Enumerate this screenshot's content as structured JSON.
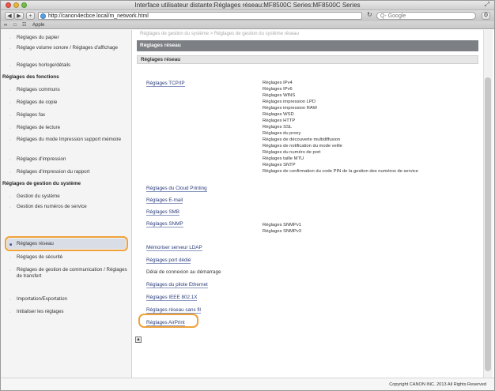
{
  "window": {
    "title": "Interface utilisateur distante:Réglages réseau:MF8500C Series:MF8500C Series"
  },
  "toolbar": {
    "url": "http://canon4ecbce.local/m_network.html",
    "search_placeholder": "Q- Google"
  },
  "bookmarks": [
    "Apple"
  ],
  "sidebar": {
    "items": [
      {
        "type": "item",
        "label": "Réglages du papier"
      },
      {
        "type": "item",
        "label": "Réglage volume sonore / Réglages d'affichage"
      },
      {
        "type": "item",
        "label": "Réglages horloge/détails"
      },
      {
        "type": "group",
        "label": "Réglages des fonctions"
      },
      {
        "type": "item",
        "label": "Réglages communs"
      },
      {
        "type": "item",
        "label": "Réglages de copie"
      },
      {
        "type": "item",
        "label": "Réglages fax"
      },
      {
        "type": "item",
        "label": "Réglages de lecture"
      },
      {
        "type": "item",
        "label": "Réglages du mode Impression support mémoire"
      },
      {
        "type": "item",
        "label": "Réglages d'impression"
      },
      {
        "type": "item",
        "label": "Réglages d'impression du rapport"
      },
      {
        "type": "group",
        "label": "Réglages de gestion du système"
      },
      {
        "type": "item",
        "label": "Gestion du système"
      },
      {
        "type": "item",
        "label": "Gestion des numéros de service"
      },
      {
        "type": "item",
        "label": "Réglages réseau",
        "active": true
      },
      {
        "type": "item",
        "label": "Réglages de sécurité"
      },
      {
        "type": "item",
        "label": "Réglages de gestion de communication / Réglages de transfert"
      },
      {
        "type": "item",
        "label": "Importation/Exportation"
      },
      {
        "type": "item",
        "label": "Initialiser les réglages"
      }
    ]
  },
  "main": {
    "prev_line": "Réglages de gestion du système > Réglages de gestion du système réseau",
    "section_title": "Réglages réseau",
    "subsection_title": "Réglages réseau",
    "tcpip": {
      "label": "Réglages TCP/IP",
      "sub_items": [
        "Réglages IPv4",
        "Réglages IPv6",
        "Réglages WINS",
        "Réglages impression LPD",
        "Réglages impression RAW",
        "Réglages WSD",
        "Réglages HTTP",
        "Réglages SSL",
        "Réglages du proxy",
        "Réglages de découverte multidiffusion",
        "Réglages de notification du mode veille",
        "Réglages du numéro de port",
        "Réglages taille MTU",
        "Réglages SNTP",
        "Réglages de confirmation du code PIN de la gestion des numéros de service"
      ]
    },
    "links": [
      "Réglages du Cloud Printing",
      "Réglages E-mail",
      "Réglages SMB",
      "Réglages SNMP"
    ],
    "snmp_sub_items": [
      "Réglages SNMPv1",
      "Réglages SNMPv3"
    ],
    "links2": [
      "Mémoriser serveur LDAP",
      "Réglages port dédié",
      "Délai de connexion au démarrage",
      "Réglages du pilote Ethernet",
      "Réglages IEEE 802.1X",
      "Réglages réseau sans fil",
      "Réglages AirPrint"
    ]
  },
  "footer": {
    "copyright": "Copyright CANON INC. 2013 All Rights Reserved"
  }
}
